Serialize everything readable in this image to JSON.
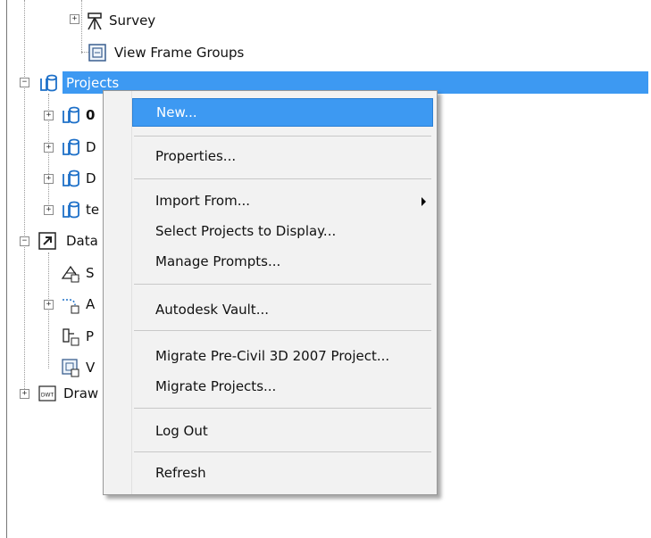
{
  "tree": {
    "survey": "Survey",
    "view_frame_groups": "View Frame Groups",
    "projects": "Projects",
    "children": [
      "0",
      "D",
      "D",
      "te"
    ],
    "data": "Data",
    "data_children": [
      "S",
      "A",
      "P",
      "V"
    ],
    "drawings": "Draw"
  },
  "context_menu": {
    "items": [
      "New...",
      "Properties...",
      "Import From...",
      "Select Projects to Display...",
      "Manage Prompts...",
      "Autodesk Vault...",
      "Migrate Pre-Civil 3D 2007 Project...",
      "Migrate Projects...",
      "Log Out",
      "Refresh"
    ]
  },
  "colors": {
    "selection": "#3d99f2",
    "menu_bg": "#f2f2f2"
  }
}
